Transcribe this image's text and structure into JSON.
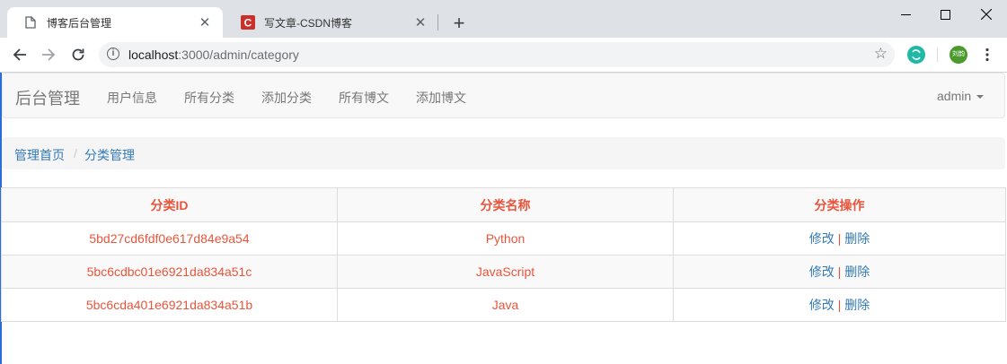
{
  "browser": {
    "tabs": [
      {
        "title": "博客后台管理",
        "icon": "page-icon"
      },
      {
        "title": "写文章-CSDN博客",
        "icon": "csdn-icon"
      }
    ],
    "url_host": "localhost",
    "url_path": ":3000/admin/category",
    "profile_label": "刘韵"
  },
  "navbar": {
    "brand": "后台管理",
    "links": [
      "用户信息",
      "所有分类",
      "添加分类",
      "所有博文",
      "添加博文"
    ],
    "user": "admin"
  },
  "breadcrumb": {
    "home": "管理首页",
    "current": "分类管理"
  },
  "table": {
    "headers": [
      "分类ID",
      "分类名称",
      "分类操作"
    ],
    "rows": [
      {
        "id": "5bd27cd6fdf0e617d84e9a54",
        "name": "Python"
      },
      {
        "id": "5bc6cdbc01e6921da834a51c",
        "name": "JavaScript"
      },
      {
        "id": "5bc6cda401e6921da834a51b",
        "name": "Java"
      }
    ],
    "edit_label": "修改",
    "sep": "|",
    "delete_label": "删除"
  },
  "colors": {
    "accent": "#e9553b",
    "link": "#337ab7"
  }
}
